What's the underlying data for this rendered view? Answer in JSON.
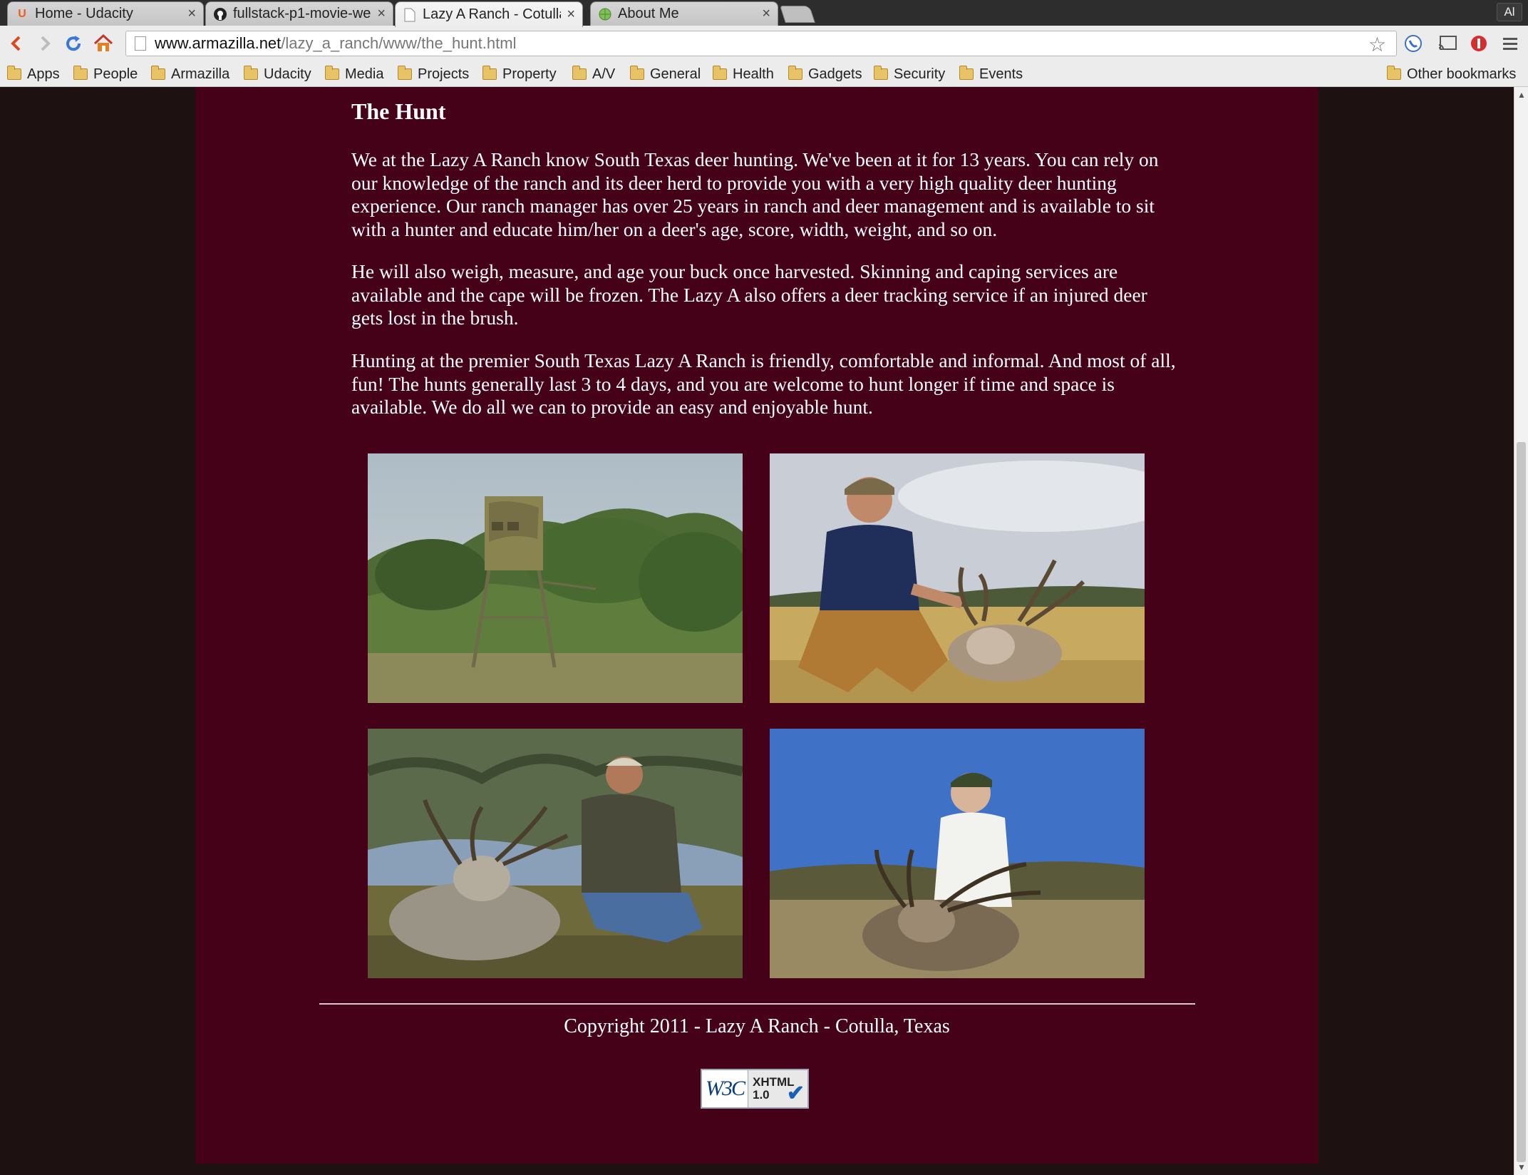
{
  "browser": {
    "tabs": [
      {
        "title": "Home - Udacity",
        "icon": "udacity-icon",
        "active": false
      },
      {
        "title": "fullstack-p1-movie-we",
        "icon": "github-icon",
        "active": false
      },
      {
        "title": "Lazy A Ranch - Cotulla",
        "icon": "page-icon",
        "active": true
      },
      {
        "title": "About Me",
        "icon": "globe-icon",
        "active": false
      }
    ],
    "profile_label": "Al",
    "url_host": "www.armazilla.net",
    "url_path": "/lazy_a_ranch/www/the_hunt.html",
    "bookmarks": [
      "Apps",
      "People",
      "Armazilla",
      "Udacity",
      "Media",
      "Projects",
      "Property",
      "A/V",
      "General",
      "Health",
      "Gadgets",
      "Security",
      "Events"
    ],
    "other_bookmarks": "Other bookmarks"
  },
  "page": {
    "title": "The Hunt",
    "paragraphs": [
      "We at the Lazy A Ranch know South Texas deer hunting. We've been at it for 13 years. You can rely on our knowledge of the ranch and its deer herd to provide you with a very high quality deer hunting experience. Our ranch manager has over 25 years in ranch and deer management and is available to sit with a hunter and educate him/her on a deer's age, score, width, weight, and so on.",
      "He will also weigh, measure, and age your buck once harvested. Skinning and caping services are available and the cape will be frozen. The Lazy A also offers a deer tracking service if an injured deer gets lost in the brush.",
      "Hunting at the premier South Texas Lazy A Ranch is friendly, comfortable and informal. And most of all, fun! The hunts generally last 3 to 4 days, and you are welcome to hunt longer if time and space is available. We do all we can to provide an easy and enjoyable hunt."
    ],
    "photos": [
      "hunting-blind-photo",
      "hunter-with-buck-photo-1",
      "hunter-with-buck-photo-2",
      "young-hunter-with-buck-photo"
    ],
    "copyright": "Copyright 2011 - Lazy A Ranch - Cotulla, Texas",
    "badge": {
      "left": "W3C",
      "line1": "XHTML",
      "line2": "1.0"
    }
  },
  "colors": {
    "page_background": "#1e1112",
    "content_background": "#440118",
    "text": "#ffffff"
  }
}
